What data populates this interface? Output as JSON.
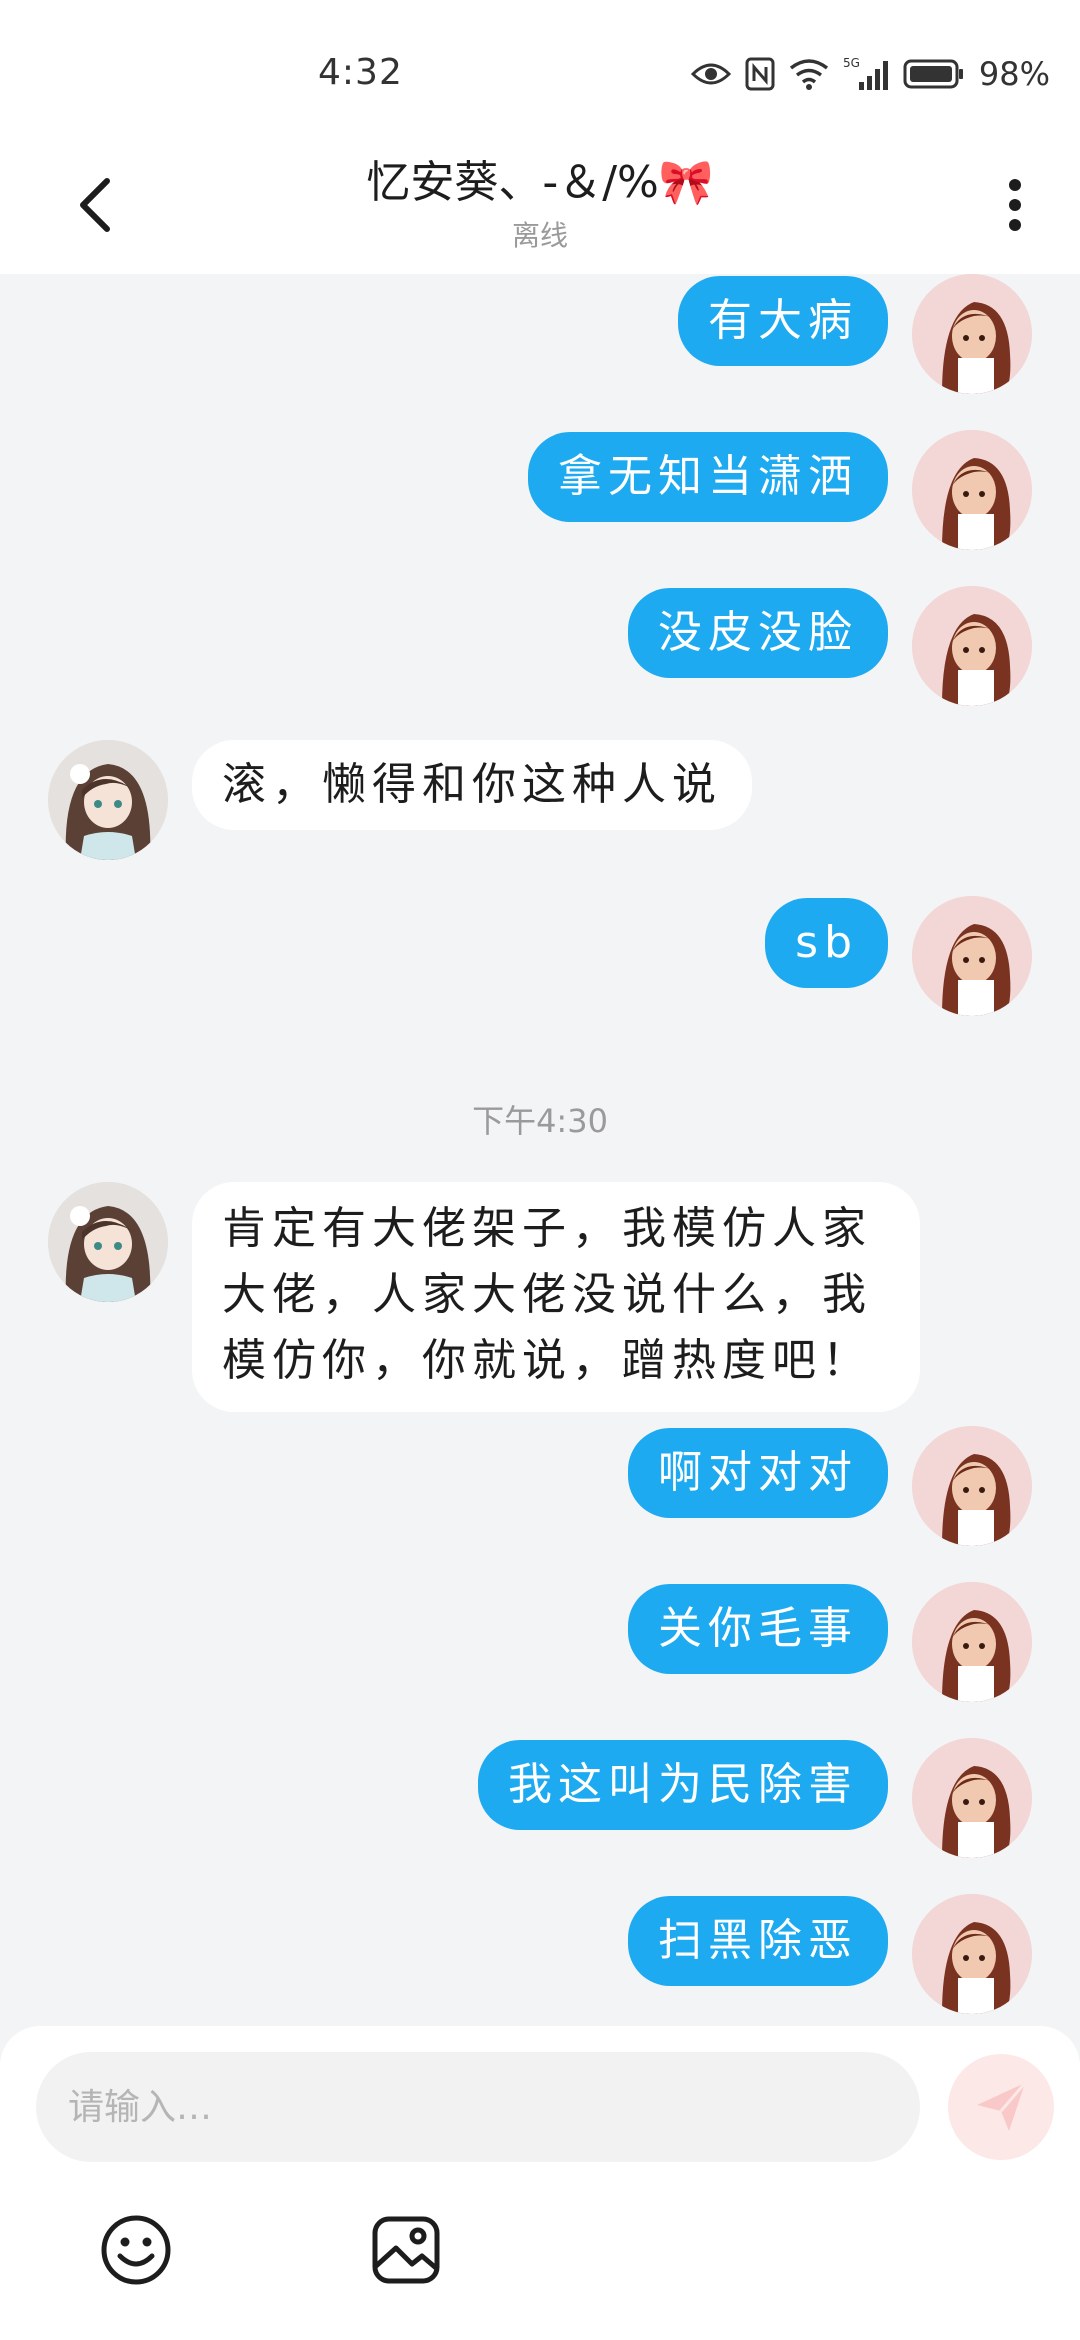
{
  "status_bar": {
    "time": "4:32",
    "battery": "98%",
    "icons": [
      "eye-icon",
      "nfc-icon",
      "wifi-icon",
      "signal-5g-icon",
      "battery-icon"
    ]
  },
  "header": {
    "title": "忆安葵、-＆/%🎀",
    "subtitle": "离线",
    "back_icon": "chevron-left-icon",
    "more_icon": "more-vertical-icon"
  },
  "colors": {
    "my_bubble": "#1eaaf1",
    "their_bubble": "#ffffff",
    "background": "#f3f4f6"
  },
  "messages": [
    {
      "from": "me",
      "text": "有大病"
    },
    {
      "from": "me",
      "text": "拿无知当潇洒"
    },
    {
      "from": "me",
      "text": "没皮没脸"
    },
    {
      "from": "them",
      "text": "滚，懒得和你这种人说"
    },
    {
      "from": "me",
      "text": "sb"
    },
    {
      "type": "time",
      "text": "下午4:30"
    },
    {
      "from": "them",
      "text": "肯定有大佬架子，我模仿人家大佬，人家大佬没说什么，我模仿你，你就说，蹭热度吧！"
    },
    {
      "from": "me",
      "text": "啊对对对"
    },
    {
      "from": "me",
      "text": "关你毛事"
    },
    {
      "from": "me",
      "text": "我这叫为民除害"
    },
    {
      "from": "me",
      "text": "扫黑除恶"
    }
  ],
  "composer": {
    "placeholder": "请输入…",
    "value": "",
    "send_icon": "send-icon",
    "emoji_icon": "emoji-icon",
    "image_icon": "image-icon"
  }
}
